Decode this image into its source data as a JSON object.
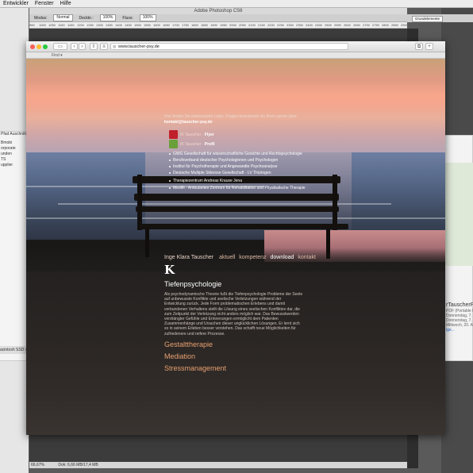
{
  "menubar": {
    "items": [
      "Entwickler",
      "Fenster",
      "Hilfe"
    ]
  },
  "background_left": {
    "panel_tabs": "Pfad   Auschnitt",
    "rows": [
      "Bmobi",
      "orporate",
      "unden",
      "TS",
      "upplier"
    ],
    "bottom_label": "acintosh SSD ›"
  },
  "background_right": {
    "title": "rTauscherPri",
    "subtitle": "PDF (Portable D",
    "lines": [
      "Donnerstag, 7. A",
      "Donnerstag, 7. A",
      "Mittwoch, 20. Au"
    ],
    "link": "ige..."
  },
  "photoshop": {
    "title": "Adobe Photoshop CS6",
    "options": {
      "mode_label": "Modus:",
      "mode_value": "Normal",
      "opacity_label": "Deckkr.:",
      "opacity_value": "100%",
      "flow_label": "Fluss:",
      "flow_value": "100%",
      "workspace": "Grundelemente"
    },
    "ruler_ticks": [
      "960",
      "1000",
      "1050",
      "1100",
      "1150",
      "1200",
      "1250",
      "1300",
      "1350",
      "1400",
      "1450",
      "1500",
      "1550",
      "1600",
      "1650",
      "1700",
      "1750",
      "1800",
      "1850",
      "1900",
      "1950",
      "2000",
      "2050",
      "2100",
      "2150",
      "2200",
      "2250",
      "2300",
      "2350",
      "2400",
      "2450",
      "2500",
      "2550",
      "2600",
      "2650",
      "2700",
      "2750",
      "2800",
      "2850",
      "2900",
      "2950",
      "3000",
      "3050",
      "3100",
      "3150",
      "3200",
      "3250",
      "3300"
    ],
    "status": {
      "zoom": "66,67%",
      "doc": "Dok: 6,66 MB/17,4 MB"
    }
  },
  "browser": {
    "url": "www.tauscher-psy.de",
    "bookmark_folder": "Find ▾",
    "back": "‹",
    "forward": "›"
  },
  "site": {
    "intro_text": "Hier finden Sie interessante Links. Fragen beantworte ich Ihnen gerne über:",
    "email": "kontakt@tauscher-psy.de",
    "flyers": [
      {
        "prefix": "IK Tauscher -",
        "label": "Flyer",
        "color": "#c0202a"
      },
      {
        "prefix": "IK Tauscher -",
        "label": "Profil",
        "color": "#6aa03a"
      }
    ],
    "links": [
      "GWG Gesellschaft für wissenschaftliche Gesichts und Rechtspsychologie",
      "Berufsverband deutscher Psychologinnen und Psychologen",
      "Institut für Psychotherapie und Angewandte Psychoanalyse",
      "Deutsche Multiple Sklerose Gesellschaft - LV Thüringen",
      "Therapiezentrum Andreas Krause Jena",
      "Medifit - Ambulantes Zentrum für Rehabilitation und Physikalische Therapie"
    ],
    "nav": {
      "name": "Inge Klara Tauscher",
      "items": [
        "aktuell",
        "kompetenz",
        "download",
        "kontakt"
      ],
      "active": "download"
    },
    "logo": "K",
    "heading": "Tiefenpsychologie",
    "paragraph": "Als psychodynamische Theorie fußt die Tiefenpsychologie Probleme der Seele auf unbewusste Konflikte und seelische Verletzungen während der Entwicklung zurück. Jede Form problematischen Erlebens und damit verbundenen Verhaltens stellt die Lösung eines seelischen Konfliktes dar, die zum Zeitpunkt der Verletzung nicht anders möglich war. Das Bewusstwerden verdrängter Gefühle und Erinnerungen ermöglicht dem Patienten Zusammenhänge und Ursachen dieser unglücklichen Lösungen. Er lernt sich so in seinem Erleben besser verstehen. Das schafft neue Möglichkeiten für zufriedenere und reifere Prozesse.",
    "services": [
      "Gestalttherapie",
      "Mediation",
      "Stressmanagement"
    ],
    "accent_color": "#e7a070"
  }
}
